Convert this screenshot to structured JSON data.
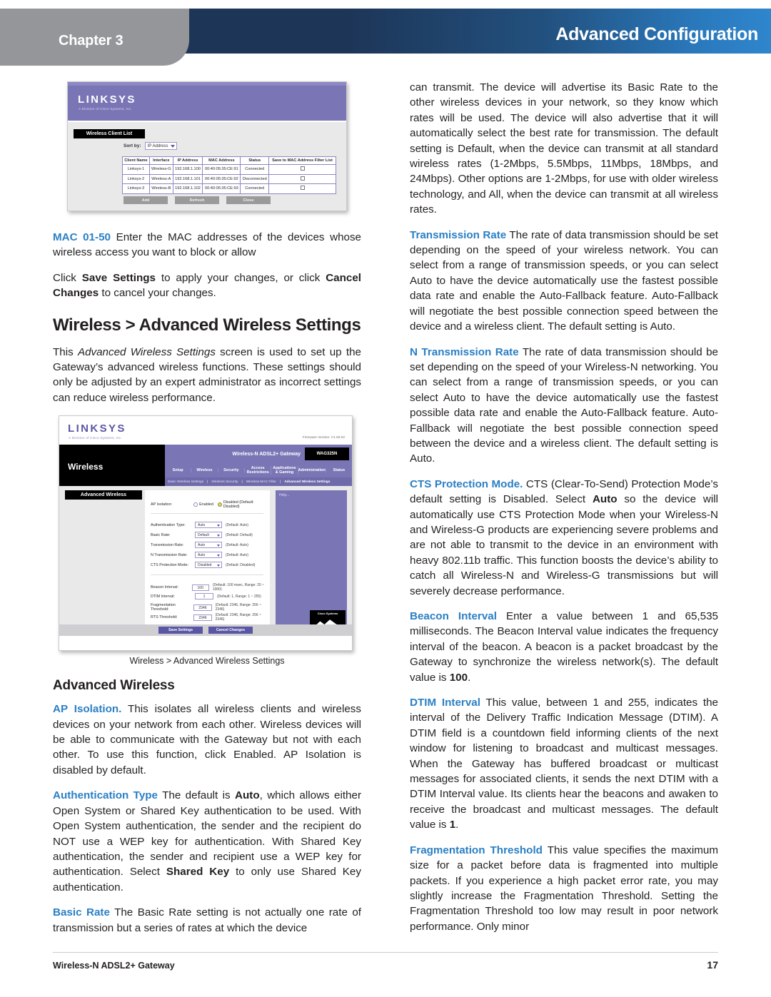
{
  "header": {
    "chapter_label": "Chapter 3",
    "title": "Advanced Configuration",
    "accent_dark": "#1d3557",
    "accent_light": "#2f86cc",
    "tab_gray": "#949699"
  },
  "footer": {
    "product": "Wireless-N ADSL2+ Gateway",
    "page_number": "17"
  },
  "left_column": {
    "para_mac_term": "MAC 01-50",
    "para_mac_rest": " Enter the MAC addresses of the devices whose wireless access you want to block or allow",
    "para_save_1": "Click ",
    "para_save_b1": "Save Settings",
    "para_save_2": " to apply your changes, or click ",
    "para_save_b2": "Cancel Changes",
    "para_save_3": " to cancel your changes.",
    "heading_wireless_adv": "Wireless > Advanced Wireless Settings",
    "para_intro_1": "This ",
    "para_intro_ital": "Advanced Wireless Settings",
    "para_intro_2": " screen is used to set up the Gateway’s advanced wireless functions. These settings should only be adjusted by an expert administrator as incorrect settings can reduce wireless performance.",
    "figure_caption": "Wireless > Advanced Wireless Settings",
    "heading_advanced_wireless": "Advanced Wireless",
    "para_ap_term": "AP Isolation.",
    "para_ap_rest": "  This isolates all wireless clients and wireless devices on your network from each other. Wireless devices will be able to communicate with the Gateway but not with each other. To use this function, click Enabled. AP Isolation is disabled by default.",
    "para_auth_term": "Authentication Type",
    "para_auth_1": " The default is ",
    "para_auth_b": "Auto",
    "para_auth_2": ", which allows either Open System or Shared Key authentication to be used. With Open System authentication, the sender and the recipient do NOT use a WEP key for authentication. With Shared Key authentication, the sender and recipient use a WEP key for authentication. Select ",
    "para_auth_b2": "Shared Key",
    "para_auth_3": " to only use Shared Key authentication.",
    "para_basic_term": "Basic Rate",
    "para_basic_rest": " The Basic Rate setting is not actually one rate of transmission but a series of rates at which the device"
  },
  "right_column": {
    "para_cont": "can transmit. The device will advertise its Basic Rate to the other wireless devices in your network, so they know which rates will be used. The device will also advertise that it will automatically select the best rate for transmission. The default setting is Default, when the device can transmit at all standard wireless rates (1-2Mbps, 5.5Mbps, 11Mbps, 18Mbps, and 24Mbps). Other options are 1-2Mbps, for use with older wireless technology, and All, when the device can transmit at all wireless rates.",
    "para_tr_term": "Transmission Rate",
    "para_tr_rest": "  The rate of data transmission should be set depending on the speed of your wireless network. You can select from a range of transmission speeds, or you can select Auto to have the device automatically use the fastest possible data rate and enable the Auto-Fallback feature. Auto-Fallback will negotiate the best possible connection speed between the device and a wireless client. The default setting is Auto.",
    "para_ntr_term": "N Transmission Rate",
    "para_ntr_rest": " The rate of data transmission should be set depending on the speed of your Wireless-N networking. You can select from a range of transmission speeds, or you can select Auto to have the device automatically use the fastest possible data rate and enable the Auto-Fallback feature. Auto-Fallback will negotiate the best possible connection speed between the device and a wireless client. The default setting is Auto.",
    "para_cts_term": "CTS Protection Mode.",
    "para_cts_1": " CTS (Clear-To-Send) Protection Mode’s default setting is Disabled. Select ",
    "para_cts_b": "Auto",
    "para_cts_2": " so the device will automatically use CTS Protection Mode when your Wireless-N and Wireless-G products are experiencing severe problems and are not able to transmit to the device in an environment with heavy 802.11b traffic. This function boosts the device’s ability to catch all Wireless-N and Wireless-G transmissions but will severely decrease performance.",
    "para_beacon_term": "Beacon Interval",
    "para_beacon_1": " Enter a value between 1 and 65,535 milliseconds. The Beacon Interval value indicates the frequency interval of the beacon. A beacon is a packet broadcast by the Gateway to synchronize the wireless network(s). The default value is ",
    "para_beacon_b": "100",
    "para_beacon_2": ".",
    "para_dtim_term": "DTIM Interval",
    "para_dtim_1": "  This value, between 1 and 255, indicates the interval of the Delivery Traffic Indication Message (DTIM). A DTIM field is a countdown field informing clients of the next window for listening to broadcast and multicast messages. When the Gateway has buffered broadcast or multicast messages for associated clients, it sends the next DTIM with a DTIM Interval value. Its clients hear the beacons and awaken to receive the broadcast and multicast messages. The default value is ",
    "para_dtim_b": "1",
    "para_dtim_2": ".",
    "para_frag_term": "Fragmentation Threshold",
    "para_frag_rest": " This value specifies the maximum size for a packet before data is fragmented into multiple packets. If you experience a high packet error rate, you may slightly increase the Fragmentation Threshold. Setting the Fragmentation Threshold too low may result in poor network performance. Only minor"
  },
  "figure_client_list": {
    "brand": "LINKSYS",
    "brand_sub": "A Division of Cisco Systems, Inc.",
    "panel_title": "Wireless Client List",
    "sort_label": "Sort by:",
    "sort_value": "IP Address",
    "columns": [
      "Client Name",
      "Interface",
      "IP Address",
      "MAC Address",
      "Status",
      "Save to MAC Address Filter List"
    ],
    "rows": [
      [
        "Linksys-1",
        "Wireless-G",
        "192.168.1.100",
        "00:40:05:35:CE:91",
        "Connected"
      ],
      [
        "Linksys-2",
        "Wireless-A",
        "192.168.1.101",
        "00:40:05:35:CE:92",
        "Disconnected"
      ],
      [
        "Linksys-3",
        "Wireless-B",
        "192.168.1.102",
        "00:40:05:35:CE:93",
        "Connected"
      ]
    ],
    "buttons": [
      "Add",
      "Refresh",
      "Close"
    ]
  },
  "figure_advanced_wireless": {
    "brand": "LINKSYS",
    "brand_sub": "A Division of Cisco Systems, Inc.",
    "firmware": "Firmware Version: V1.00.02",
    "model_name": "Wireless-N ADSL2+ Gateway",
    "model_code": "WAG325N",
    "section_title": "Wireless",
    "tabs": [
      "Setup",
      "Wireless",
      "Security",
      "Access Restrictions",
      "Applications & Gaming",
      "Administration",
      "Status"
    ],
    "subtabs": [
      "Basic Wireless Settings",
      "Wireless Security",
      "Wireless MAC Filter",
      "Advanced Wireless Settings"
    ],
    "subtab_active": "Advanced Wireless Settings",
    "panel_title": "Advanced Wireless",
    "help_label": "Help...",
    "help_brand": "Cisco Systems",
    "ap_isolation_label": "AP Isolation:",
    "ap_isolation_enabled": "Enabled",
    "ap_isolation_disabled": "Disabled (Default: Disabled)",
    "select_fields": [
      {
        "label": "Authentication Type:",
        "value": "Auto",
        "hint": "(Default: Auto)"
      },
      {
        "label": "Basic Rate:",
        "value": "Default",
        "hint": "(Default: Default)"
      },
      {
        "label": "Transmission Rate:",
        "value": "Auto",
        "hint": "(Default: Auto)"
      },
      {
        "label": "N Transmission Rate:",
        "value": "Auto",
        "hint": "(Default: Auto)"
      },
      {
        "label": "CTS Protection Mode:",
        "value": "Disabled",
        "hint": "(Default: Disabled)"
      }
    ],
    "text_fields": [
      {
        "label": "Beacon Interval:",
        "value": "100",
        "hint": "(Default: 100 msec, Range: 20 ~ 1000)"
      },
      {
        "label": "DTIM Interval:",
        "value": "1",
        "hint": "(Default: 1, Range: 1 ~ 255)"
      },
      {
        "label": "Fragmentation Threshold:",
        "value": "2346",
        "hint": "(Default: 2346, Range: 256 ~ 2346)"
      },
      {
        "label": "RTS Threshold:",
        "value": "2346",
        "hint": "(Default: 2346, Range: 256 ~ 2346)"
      }
    ],
    "buttons": [
      "Save Settings",
      "Cancel Changes"
    ]
  }
}
